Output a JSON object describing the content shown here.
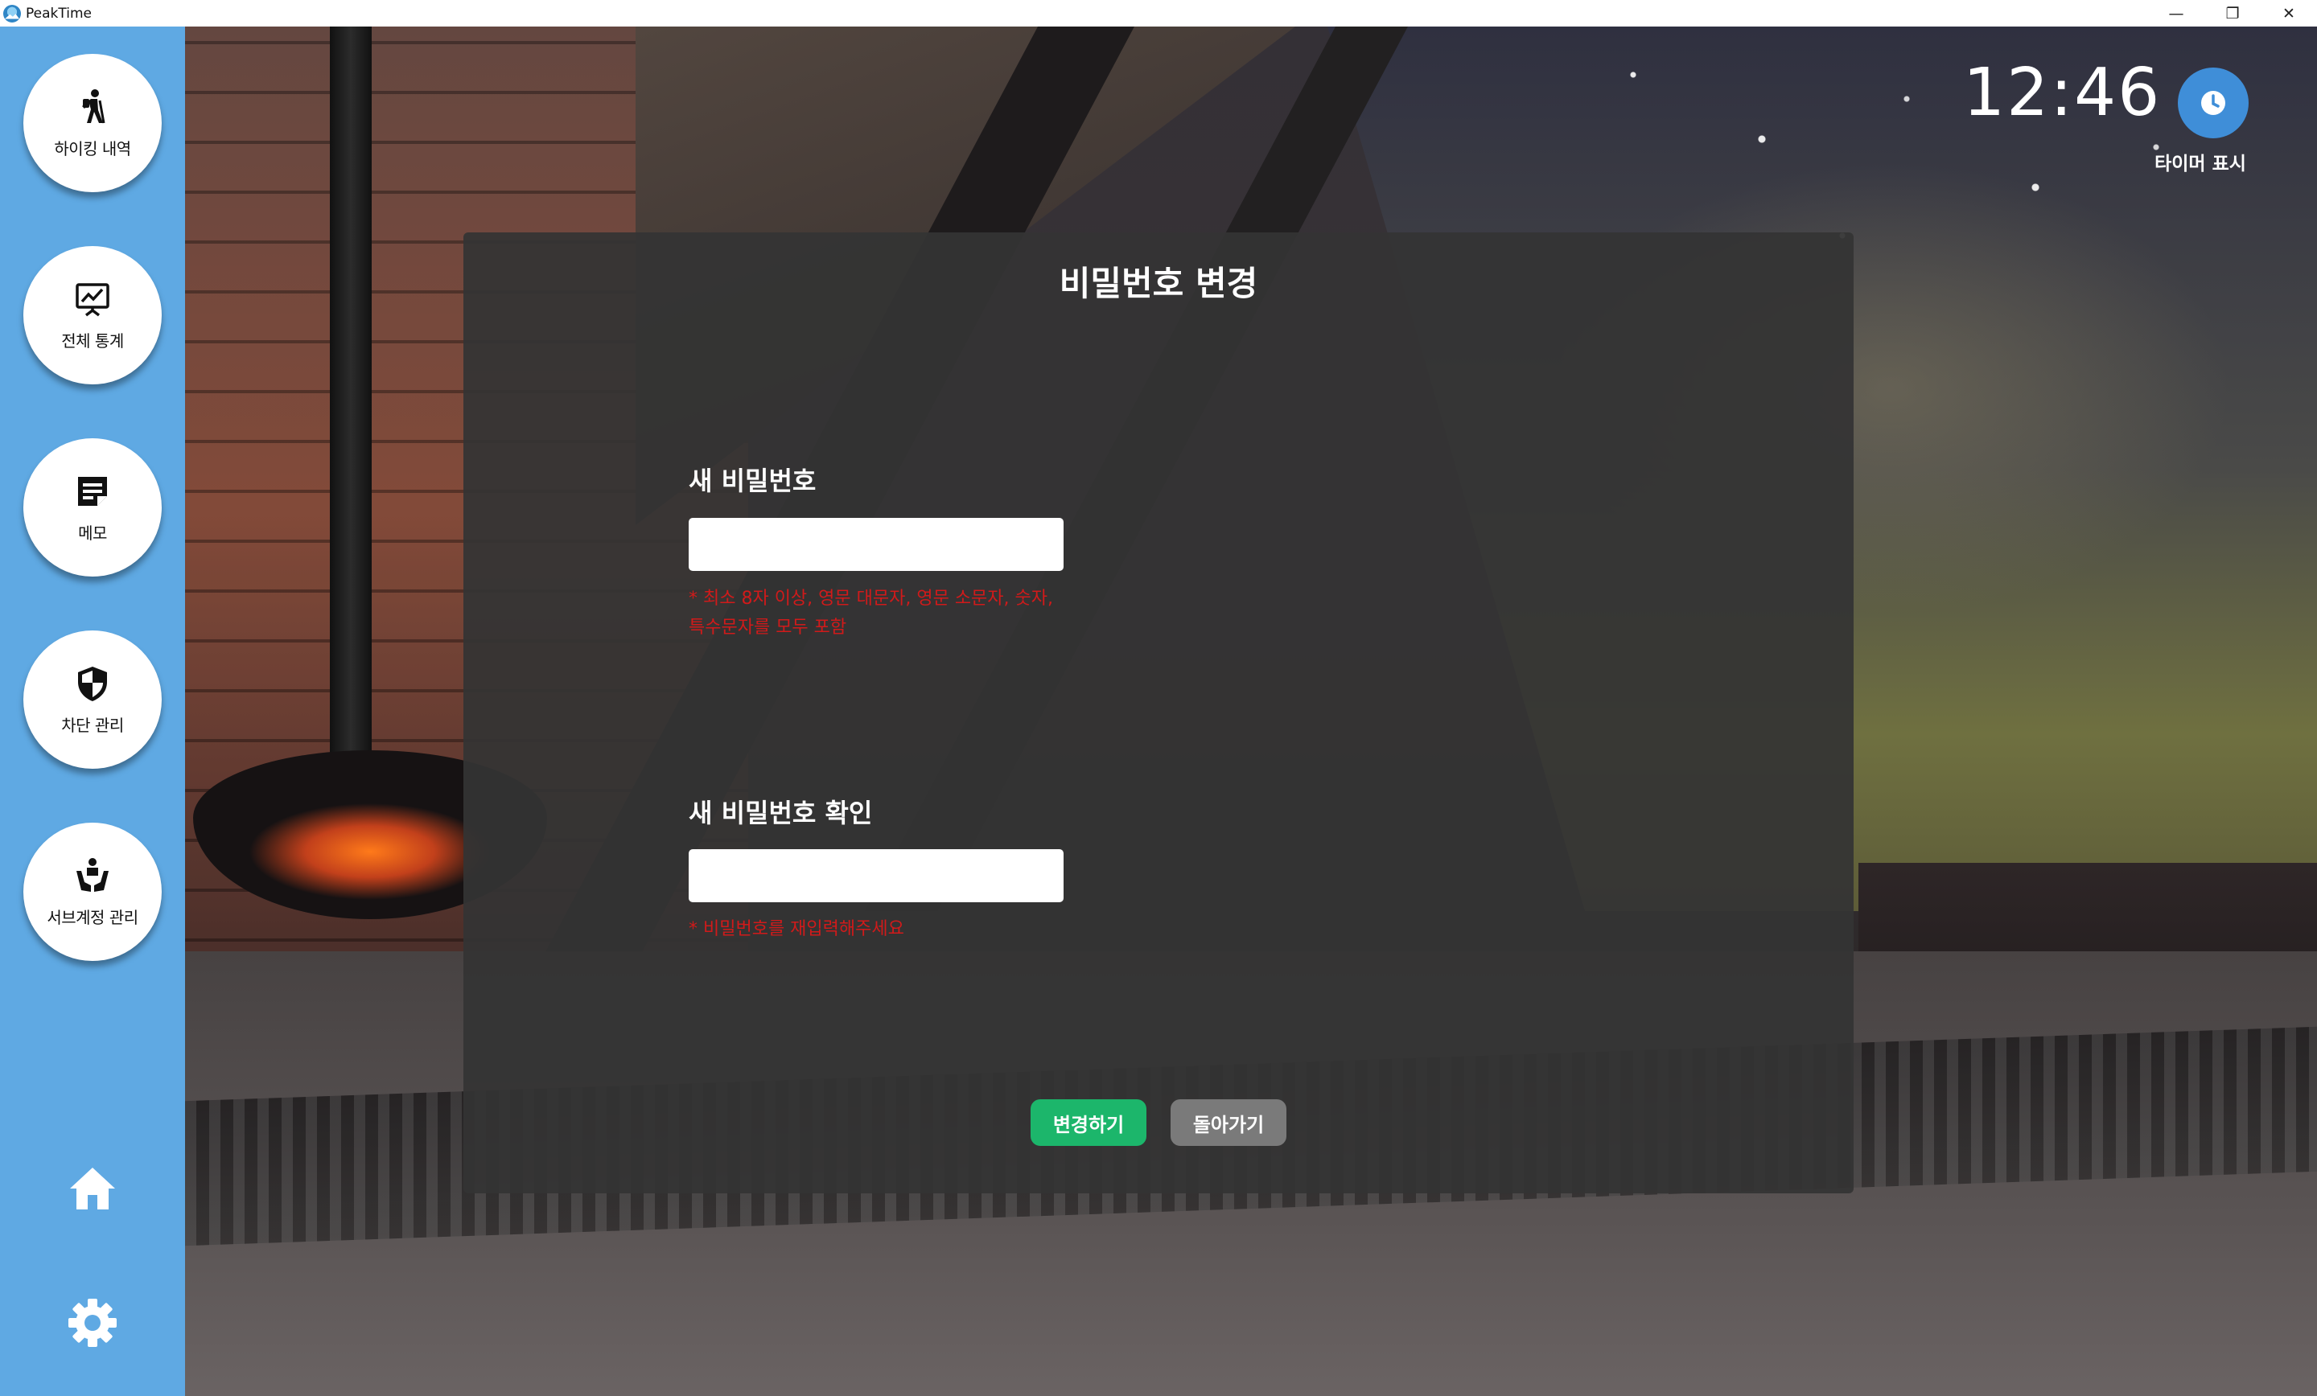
{
  "window": {
    "app_title": "PeakTime",
    "controls": {
      "minimize": "—",
      "restore": "❐",
      "close": "✕"
    }
  },
  "sidebar": {
    "items": [
      {
        "label": "하이킹 내역",
        "icon": "hiking-icon"
      },
      {
        "label": "전체 통계",
        "icon": "statistics-chart-icon"
      },
      {
        "label": "메모",
        "icon": "memo-icon"
      },
      {
        "label": "차단 관리",
        "icon": "shield-icon"
      },
      {
        "label": "서브계정 관리",
        "icon": "sub-account-icon"
      }
    ],
    "bottom_icons": [
      "home-icon",
      "gear-icon"
    ]
  },
  "header": {
    "clock": "12:46",
    "timer_label": "타이머 표시",
    "timer_icon": "clock-icon"
  },
  "modal": {
    "title": "비밀번호 변경",
    "new_password": {
      "label": "새 비밀번호",
      "value": "",
      "hint_line1": "* 최소 8자 이상, 영문 대문자, 영문 소문자, 숫자,",
      "hint_line2": "특수문자를 모두 포함"
    },
    "confirm_password": {
      "label": "새 비밀번호 확인",
      "value": "",
      "hint": "* 비밀번호를 재입력해주세요"
    },
    "buttons": {
      "submit": "변경하기",
      "back": "돌아가기"
    }
  },
  "colors": {
    "sidebar": "#5fa9e3",
    "timer_button": "#3f8ed8",
    "modal_bg": "#343434",
    "primary_button": "#1cb66b",
    "secondary_button": "#7a7a7a",
    "hint_text": "#d11a1a"
  }
}
